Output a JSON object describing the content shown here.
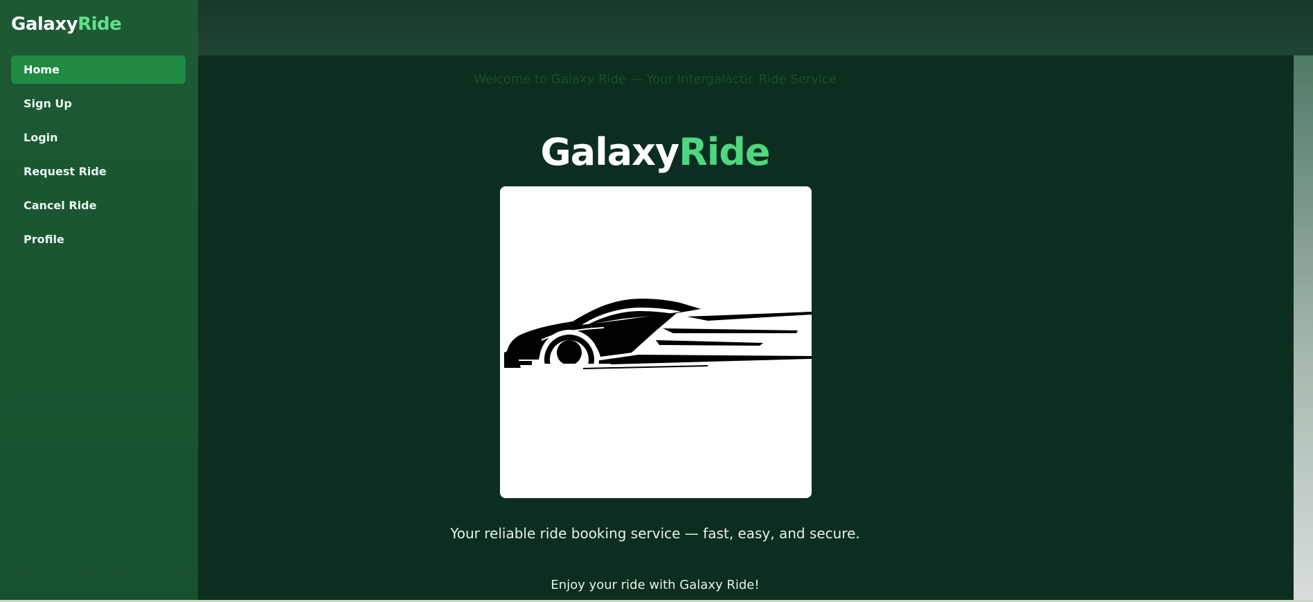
{
  "brand": {
    "name_primary": "Galaxy",
    "name_accent": "Ride"
  },
  "sidebar": {
    "items": [
      {
        "label": "Home",
        "active": true
      },
      {
        "label": "Sign Up",
        "active": false
      },
      {
        "label": "Login",
        "active": false
      },
      {
        "label": "Request Ride",
        "active": false
      },
      {
        "label": "Cancel Ride",
        "active": false
      },
      {
        "label": "Profile",
        "active": false
      }
    ]
  },
  "main": {
    "welcome_text": "Welcome to Galaxy Ride — Your Intergalactic Ride Service",
    "hero_title_primary": "Galaxy",
    "hero_title_accent": "Ride",
    "logo_icon": "sports-car-icon",
    "tagline": "Your reliable ride booking service — fast, easy, and secure.",
    "enjoy_text": "Enjoy your ride with Galaxy Ride!"
  },
  "colors": {
    "sidebar_bg": "#1a5530",
    "active_item_bg": "#1f8a44",
    "accent_green": "#4fd67f",
    "main_bg": "#0c2e20"
  }
}
